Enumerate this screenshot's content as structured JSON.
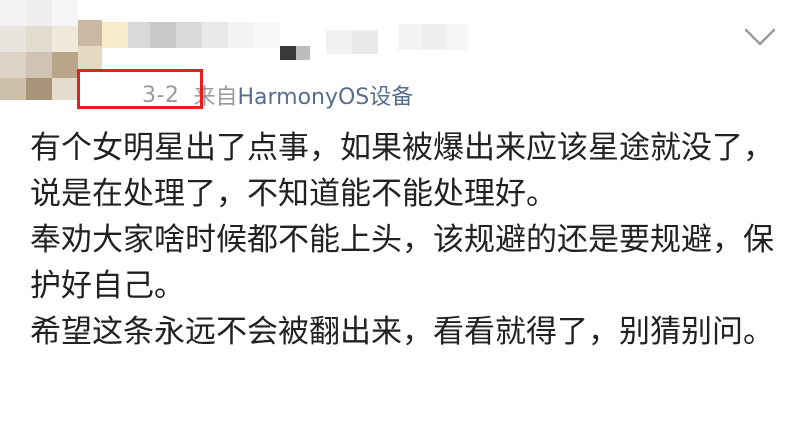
{
  "post": {
    "time": "3-2",
    "source_from": "来自",
    "source_device": "HarmonyOS设备",
    "paragraphs": [
      "有个女明星出了点事，如果被爆出来应该星途就没了，说是在处理了，不知道能不能处理好。",
      "奉劝大家啥时候都不能上头，该规避的还是要规避，保护好自己。",
      "希望这条永远不会被翻出来，看看就得了，别猜别问。"
    ]
  },
  "icons": {
    "expand": "chevron-down-icon"
  },
  "colors": {
    "highlight_box": "#ee1d1d",
    "device_link": "#566f8f",
    "meta_gray": "#9a9a9a",
    "body_text": "#222222"
  }
}
